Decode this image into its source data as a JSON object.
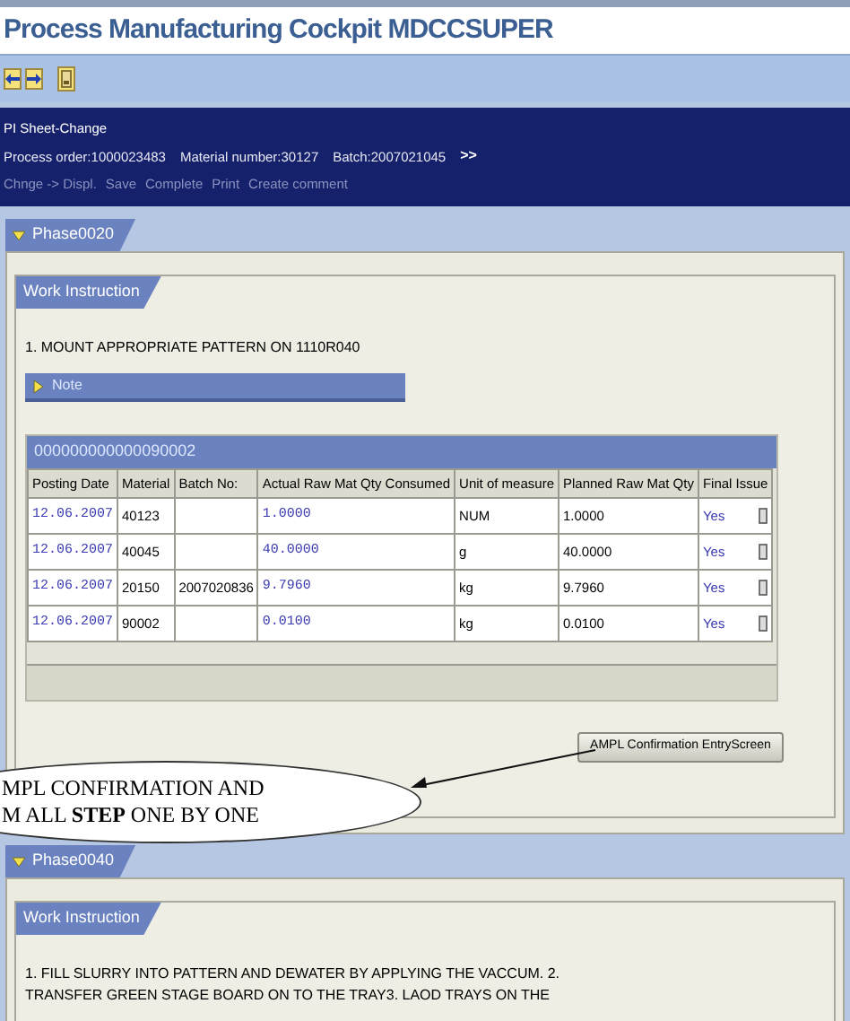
{
  "window": {
    "title": "Process Manufacturing Cockpit MDCCSUPER"
  },
  "header": {
    "title": "PI Sheet-Change",
    "info": [
      "Process order:1000023483",
      "Material number:30127",
      "Batch:2007021045"
    ],
    "more": ">>",
    "actions": [
      "Chnge -> Displ.",
      "Save",
      "Complete",
      "Print",
      "Create comment"
    ]
  },
  "phases": [
    {
      "name": "Phase0020",
      "expanded": true,
      "section": "Work Instruction",
      "instruction": "1. MOUNT APPROPRIATE PATTERN ON 1110R040",
      "note": {
        "label": "Note",
        "expanded": false
      },
      "table": {
        "title": "000000000000090002",
        "columns": [
          "Posting Date",
          "Material",
          "Batch No:",
          "Actual Raw Mat Qty Consumed",
          "Unit of measure",
          "Planned Raw Mat Qty",
          "Final Issue"
        ],
        "rows": [
          [
            "12.06.2007",
            "40123",
            "",
            "1.0000",
            "NUM",
            "1.0000",
            "Yes"
          ],
          [
            "12.06.2007",
            "40045",
            "",
            "40.0000",
            "g",
            "40.0000",
            "Yes"
          ],
          [
            "12.06.2007",
            "20150",
            "2007020836",
            "9.7960",
            "kg",
            "9.7960",
            "Yes"
          ],
          [
            "12.06.2007",
            "90002",
            "",
            "0.0100",
            "kg",
            "0.0100",
            "Yes"
          ]
        ]
      },
      "button": "AMPL Confirmation EntryScreen"
    },
    {
      "name": "Phase0040",
      "expanded": true,
      "section": "Work Instruction",
      "instruction": "1. FILL SLURRY INTO PATTERN AND DEWATER BY APPLYING THE VACCUM. 2. TRANSFER GREEN STAGE BOARD ON TO THE TRAY3. LAOD TRAYS ON THE"
    }
  ],
  "callout": {
    "lines": [
      "MPL CONFIRMATION AND",
      "M ALL **STEP** ONE BY ONE"
    ]
  }
}
